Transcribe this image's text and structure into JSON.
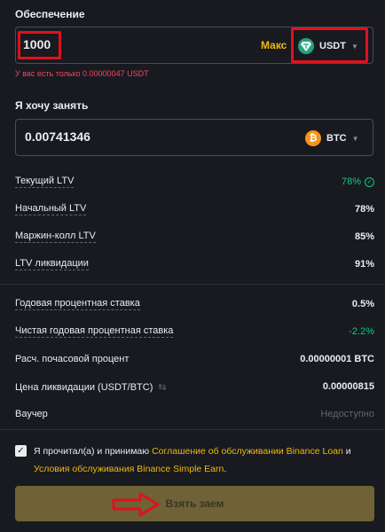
{
  "collateral": {
    "label": "Обеспечение",
    "amount": "1000",
    "max_label": "Макс",
    "coin": "USDT",
    "coin_color": "#26a17b",
    "warning": "У вас есть только 0.00000047 USDT"
  },
  "borrow": {
    "label": "Я хочу занять",
    "amount": "0.00741346",
    "coin": "BTC",
    "coin_color": "#f7931a"
  },
  "ltv_rows": [
    {
      "label": "Текущий LTV",
      "value": "78%"
    },
    {
      "label": "Начальный LTV",
      "value": "78%"
    },
    {
      "label": "Маржин-колл LTV",
      "value": "85%"
    },
    {
      "label": "LTV ликвидации",
      "value": "91%"
    }
  ],
  "rate_rows": [
    {
      "label": "Годовая процентная ставка",
      "value": "0.5%"
    },
    {
      "label": "Чистая годовая процентная ставка",
      "value": "-2.2%"
    },
    {
      "label": "Расч. почасовой процент",
      "value": "0.00000001 BTC"
    },
    {
      "label": "Цена ликвидации (USDT/BTC)",
      "value": "0.00000815"
    },
    {
      "label": "Ваучер",
      "value": "Недоступно"
    }
  ],
  "agreement": {
    "prefix": "Я прочитал(а) и принимаю ",
    "link1": "Соглашение об обслуживании Binance Loan",
    "middle": " и ",
    "link2": "Условия обслуживания Binance Simple Earn",
    "suffix": "."
  },
  "submit_label": "Взять заем",
  "colors": {
    "accent": "#f0b90b",
    "positive": "#0ecb81",
    "negative": "#f6465d",
    "highlight": "#e0111c"
  }
}
